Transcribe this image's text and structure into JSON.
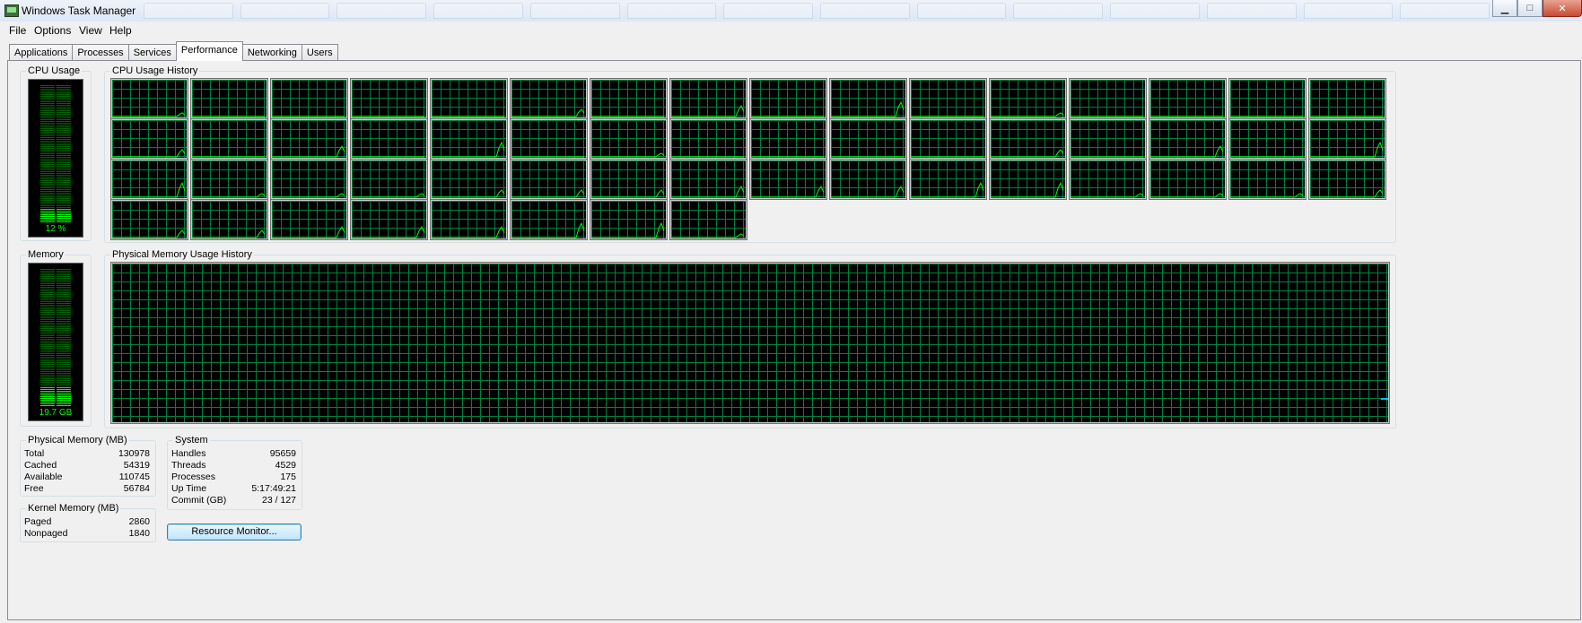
{
  "window": {
    "title": "Windows Task Manager",
    "min_glyph": "▁",
    "max_glyph": "□",
    "close_glyph": "✕"
  },
  "menu": [
    "File",
    "Options",
    "View",
    "Help"
  ],
  "tabs": [
    "Applications",
    "Processes",
    "Services",
    "Performance",
    "Networking",
    "Users"
  ],
  "active_tab": "Performance",
  "cpu": {
    "label": "CPU Usage",
    "value": "12 %",
    "percent": 12
  },
  "cpu_history": {
    "label": "CPU Usage History",
    "cores": 56
  },
  "memory": {
    "label": "Memory",
    "value": "19.7 GB",
    "fraction": 0.15
  },
  "memory_history": {
    "label": "Physical Memory Usage History"
  },
  "physical_memory": {
    "label": "Physical Memory (MB)",
    "rows": [
      {
        "name": "Total",
        "value": "130978"
      },
      {
        "name": "Cached",
        "value": "54319"
      },
      {
        "name": "Available",
        "value": "110745"
      },
      {
        "name": "Free",
        "value": "56784"
      }
    ]
  },
  "kernel_memory": {
    "label": "Kernel Memory (MB)",
    "rows": [
      {
        "name": "Paged",
        "value": "2860"
      },
      {
        "name": "Nonpaged",
        "value": "1840"
      }
    ]
  },
  "system": {
    "label": "System",
    "rows": [
      {
        "name": "Handles",
        "value": "95659"
      },
      {
        "name": "Threads",
        "value": "4529"
      },
      {
        "name": "Processes",
        "value": "175"
      },
      {
        "name": "Up Time",
        "value": "5:17:49:21"
      },
      {
        "name": "Commit (GB)",
        "value": "23 / 127"
      }
    ]
  },
  "resource_monitor_button": "Resource Monitor...",
  "colors": {
    "graph_line": "#00ff00",
    "grid": "#008040",
    "memory_line": "#00bfff"
  }
}
